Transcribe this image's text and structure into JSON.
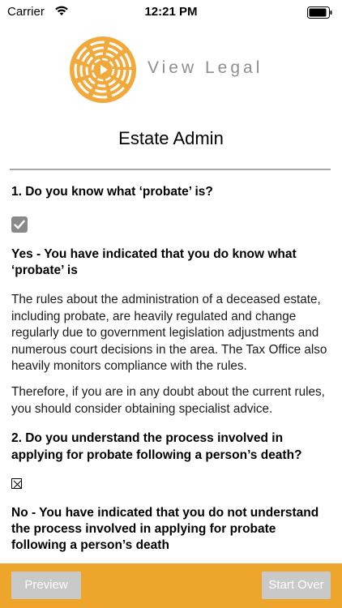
{
  "status_bar": {
    "carrier": "Carrier",
    "time": "12:21 PM"
  },
  "brand": {
    "name": "View Legal",
    "accent": "#eda52c"
  },
  "page": {
    "title": "Estate Admin"
  },
  "questions": [
    {
      "text": "1. Do you know what ‘probate’ is?",
      "checked": true,
      "answer": "Yes - You have indicated that you do know what ‘probate’ is",
      "paragraphs": [
        "The rules about the administration of a deceased estate, including probate, are heavily regulated and change regularly due to government legislation adjustments and numerous court decisions in the area. The Tax Office also heavily monitors compliance with the rules.",
        "Therefore, if you are in any doubt about the current rules, you should consider obtaining specialist advice."
      ]
    },
    {
      "text": "2. Do you understand the process involved in applying for probate following a person’s death?",
      "checked": false,
      "checkbox_glyph": "☒",
      "answer": "No - You have indicated that you do not understand the process involved in applying for probate following a person’s death"
    }
  ],
  "toolbar": {
    "preview_label": "Preview",
    "start_over_label": "Start Over"
  }
}
